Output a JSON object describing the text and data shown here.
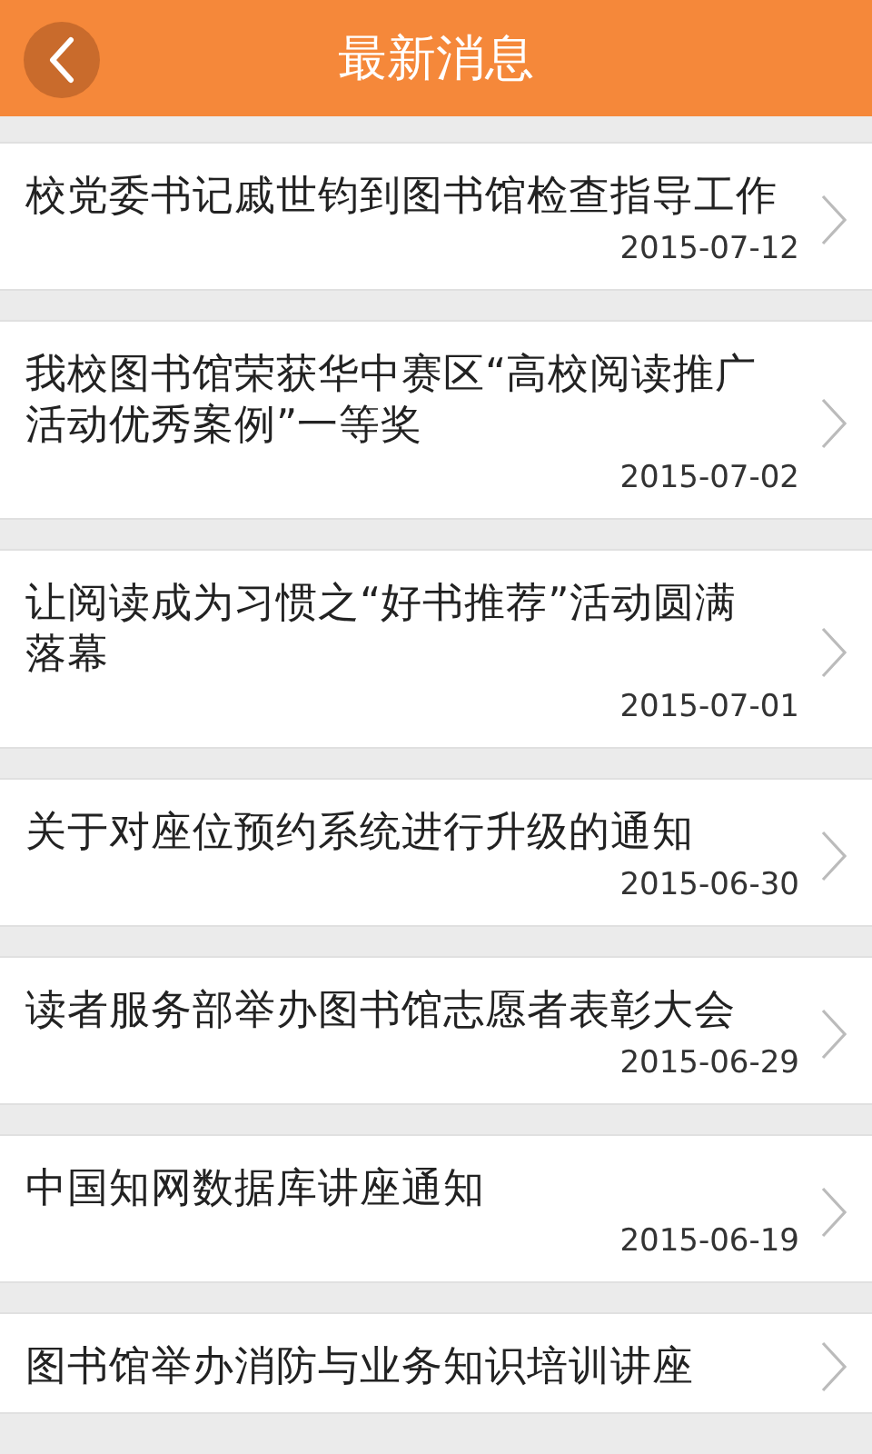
{
  "header": {
    "title": "最新消息"
  },
  "news": [
    {
      "title": "校党委书记戚世钧到图书馆检查指导工作",
      "date": "2015-07-12"
    },
    {
      "title": "我校图书馆荣获华中赛区“高校阅读推广活动优秀案例”一等奖",
      "date": "2015-07-02"
    },
    {
      "title": "让阅读成为习惯之“好书推荐”活动圆满落幕",
      "date": "2015-07-01"
    },
    {
      "title": "关于对座位预约系统进行升级的通知",
      "date": "2015-06-30"
    },
    {
      "title": "读者服务部举办图书馆志愿者表彰大会",
      "date": "2015-06-29"
    },
    {
      "title": "中国知网数据库讲座通知",
      "date": "2015-06-19"
    },
    {
      "title": "图书馆举办消防与业务知识培训讲座"
    }
  ]
}
